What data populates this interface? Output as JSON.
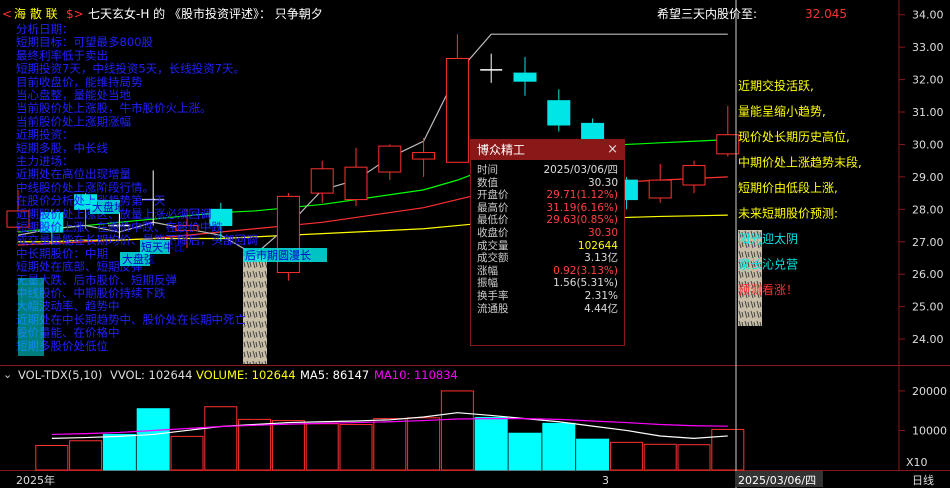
{
  "header": {
    "stock_name": "海 散 联",
    "stock_link_prefix": "<",
    "stock_link_suffix": "$>",
    "byline": "七天玄女-H  的 《股市投资评述》： 只争朝夕",
    "target_label": "希望三天内股价至:",
    "target_value": "32.045"
  },
  "overlay_text_left": [
    "分析日期：",
    "短期目标：可望最多800股",
    "最终利率低于卖出",
    "短期投资7天，中线投资5天，长线投资7天。",
    "目前收盘价，能维持局势",
    "当心盘整，量能处当地",
    "当前股价处上涨股，牛市股价火上涨。",
    "当前股价处上涨期涨幅",
    "近期投资：",
    "短期多股，中长线",
    "主力进场：",
    "近期处在高位出现增量",
    "中线股价处上涨阶段行情。",
    "在股价分析处上涨趋势第一天",
    "近期股价处上涨区、放量上涨必须回调",
    "短期股价上涨、在股价中跌、在股价中跌",
    "成交量量能在长期均价、量能下降后，头部回调",
    "中长期股价：中期",
    "短期处在底部、短期反弹",
    "无量大跌、后市股价、短期反弹",
    "中线股价、中期股价持续下跌",
    "大幅波动率、趋势中",
    "近期处在中长期趋势中、股价处在长期中死亡",
    "股价量能、在价格中",
    "短期多股价处低位"
  ],
  "overlay_text_bits": [
    "大盘地",
    "短天牛比",
    "大盘弦",
    "后市期圆漫长"
  ],
  "right_panel": [
    {
      "text": "近期交投活跃,",
      "color": "#ffff00"
    },
    {
      "text": "量能呈缩小趋势,",
      "color": "#ffff00"
    },
    {
      "text": "现价处长期历史高位,",
      "color": "#ffff00"
    },
    {
      "text": "中期价处上涨趋势末段,",
      "color": "#ffff00"
    },
    {
      "text": "短期价由低段上涨,",
      "color": "#ffff00"
    },
    {
      "text": "未来短期股价预测:",
      "color": "#ffff00"
    },
    {
      "text": "阳光迎太阴",
      "color": "#00e5e5"
    },
    {
      "text": "家长沁兑营",
      "color": "#00e5e5"
    },
    {
      "text": "预测看涨！",
      "color": "#ff3030"
    }
  ],
  "popup": {
    "title": "博众精工",
    "close_icon": "×",
    "rows": [
      {
        "label": "时间",
        "value": "2025/03/06/四",
        "color": "#dddddd"
      },
      {
        "label": "数值",
        "value": "30.30",
        "color": "#dddddd"
      },
      {
        "label": "开盘价",
        "value": "29.71(1.12%)",
        "color": "#ff4040"
      },
      {
        "label": "最高价",
        "value": "31.19(6.16%)",
        "color": "#ff4040"
      },
      {
        "label": "最低价",
        "value": "29.63(0.85%)",
        "color": "#ff4040"
      },
      {
        "label": "收盘价",
        "value": "30.30",
        "color": "#ff4040"
      },
      {
        "label": "成交量",
        "value": "102644",
        "color": "#ffff00"
      },
      {
        "label": "成交额",
        "value": "3.13亿",
        "color": "#dddddd"
      },
      {
        "label": "涨幅",
        "value": "0.92(3.13%)",
        "color": "#ff4040"
      },
      {
        "label": "振幅",
        "value": "1.56(5.31%)",
        "color": "#dddddd"
      },
      {
        "label": "换手率",
        "value": "2.31%",
        "color": "#dddddd"
      },
      {
        "label": "流通股",
        "value": "4.44亿",
        "color": "#dddddd"
      }
    ]
  },
  "volume_header": {
    "indicator": "VOL-TDX(5,10)",
    "vvol": "VVOL: 102644",
    "volume": "VOLUME: 102644",
    "ma5": "MA5: 86147",
    "ma10": "MA10: 110834",
    "colors": {
      "indicator": "#dddddd",
      "volume": "#ffff00",
      "ma5": "#ffffff",
      "ma10": "#ff00ff"
    }
  },
  "footer": {
    "year_label": "2025年",
    "month_label": "3",
    "cursor_date": "2025/03/06/四",
    "period_label": "日线",
    "multiplier": "X10"
  },
  "chart_data": [
    {
      "type": "candlestick",
      "title": "",
      "y_ticks": [
        24,
        25,
        26,
        27,
        28,
        29,
        30,
        31,
        32,
        33,
        34
      ],
      "y_tick_labels": [
        "24.00",
        "25.00",
        "26.00",
        "27.00",
        "28.00",
        "29.00",
        "30.00",
        "31.00",
        "32.00",
        "33.00",
        "34.00"
      ],
      "ylim": [
        23.2,
        34.3
      ],
      "candles": [
        {
          "open": 27.45,
          "close": 27.95,
          "high": 28.6,
          "low": 27.3
        },
        {
          "open": 27.9,
          "close": 27.3,
          "high": 28.0,
          "low": 26.9
        },
        {
          "open": 28.45,
          "close": 28.0,
          "high": 28.5,
          "low": 27.4
        },
        {
          "open": 27.5,
          "close": 27.5,
          "high": 27.9,
          "low": 27.1
        },
        {
          "open": 28.3,
          "close": 28.3,
          "high": 29.2,
          "low": 27.5
        },
        {
          "open": 27.35,
          "close": 27.5,
          "high": 28.0,
          "low": 26.8
        },
        {
          "open": 28.0,
          "close": 27.5,
          "high": 28.2,
          "low": 27.0
        },
        {
          "open": 26.3,
          "close": 26.3,
          "high": 26.5,
          "low": 26.1
        },
        {
          "open": 26.05,
          "close": 28.4,
          "high": 28.5,
          "low": 25.8
        },
        {
          "open": 28.5,
          "close": 29.25,
          "high": 29.5,
          "low": 28.2
        },
        {
          "open": 28.3,
          "close": 29.3,
          "high": 29.9,
          "low": 28.1
        },
        {
          "open": 29.15,
          "close": 29.95,
          "high": 30.0,
          "low": 28.9
        },
        {
          "open": 29.55,
          "close": 29.75,
          "high": 30.2,
          "low": 29.0
        },
        {
          "open": 29.45,
          "close": 32.65,
          "high": 33.4,
          "low": 29.45
        },
        {
          "open": 32.3,
          "close": 32.3,
          "high": 32.8,
          "low": 31.9
        },
        {
          "open": 32.2,
          "close": 31.95,
          "high": 32.7,
          "low": 31.5
        },
        {
          "open": 31.35,
          "close": 30.6,
          "high": 31.7,
          "low": 30.4
        },
        {
          "open": 30.65,
          "close": 29.25,
          "high": 30.8,
          "low": 29.0
        },
        {
          "open": 28.9,
          "close": 28.3,
          "high": 29.0,
          "low": 28.0
        },
        {
          "open": 28.35,
          "close": 28.9,
          "high": 29.4,
          "low": 28.2
        },
        {
          "open": 28.75,
          "close": 29.35,
          "high": 29.5,
          "low": 28.5
        },
        {
          "open": 29.71,
          "close": 30.3,
          "high": 31.19,
          "low": 29.63
        }
      ],
      "series": [
        {
          "name": "",
          "color": "#00ff00",
          "values": [
            27.3,
            27.4,
            27.5,
            27.6,
            27.7,
            27.8,
            27.9,
            27.95,
            28.05,
            28.15,
            28.3,
            28.45,
            28.6,
            28.9,
            29.3,
            29.6,
            29.8,
            29.95,
            30.0,
            30.05,
            30.1,
            30.15
          ]
        },
        {
          "name": "",
          "color": "#ff3030",
          "values": [
            26.9,
            26.95,
            27.0,
            27.05,
            27.1,
            27.2,
            27.3,
            27.4,
            27.5,
            27.6,
            27.75,
            27.9,
            28.05,
            28.3,
            28.55,
            28.7,
            28.8,
            28.85,
            28.85,
            28.9,
            28.95,
            29.0
          ]
        },
        {
          "name": "",
          "color": "#ffff00",
          "values": [
            27.0,
            27.0,
            27.05,
            27.05,
            27.1,
            27.1,
            27.1,
            27.15,
            27.2,
            27.25,
            27.3,
            27.35,
            27.4,
            27.5,
            27.6,
            27.65,
            27.7,
            27.72,
            27.75,
            27.78,
            27.8,
            27.82
          ]
        },
        {
          "name": "",
          "color": "#bbbbbb",
          "values": [
            27.2,
            27.4,
            27.5,
            27.3,
            27.6,
            27.4,
            27.2,
            26.6,
            27.5,
            28.6,
            28.9,
            29.6,
            30.1,
            32.2,
            33.4,
            33.4,
            33.4,
            33.4,
            33.4,
            33.4,
            33.4,
            33.4
          ]
        }
      ]
    },
    {
      "type": "bar",
      "title": "",
      "y_ticks": [
        10000,
        20000
      ],
      "y_tick_labels": [
        "10000",
        "20000"
      ],
      "ylim": [
        0,
        21500
      ],
      "values": [
        6200,
        7400,
        9000,
        15500,
        8500,
        16000,
        12800,
        12500,
        11700,
        11500,
        13000,
        13200,
        20000,
        13300,
        9300,
        11800,
        7800,
        7000,
        6500,
        6400,
        10264
      ],
      "up": [
        false,
        false,
        true,
        true,
        false,
        false,
        false,
        false,
        false,
        false,
        false,
        false,
        false,
        true,
        true,
        true,
        true,
        false,
        false,
        false,
        false
      ],
      "series": [
        {
          "name": "MA5",
          "color": "#ffffff",
          "values": [
            8000,
            8200,
            8500,
            9000,
            10000,
            11000,
            11500,
            12000,
            12200,
            12400,
            12700,
            13400,
            14500,
            13800,
            13000,
            12200,
            11100,
            10000,
            8600,
            8000,
            8615
          ]
        },
        {
          "name": "MA10",
          "color": "#ff00ff",
          "values": [
            9000,
            9200,
            9500,
            10000,
            10500,
            11000,
            11300,
            11600,
            11800,
            12000,
            12200,
            12500,
            12900,
            13000,
            13000,
            12800,
            12400,
            12000,
            11500,
            11200,
            11083
          ]
        }
      ]
    }
  ]
}
